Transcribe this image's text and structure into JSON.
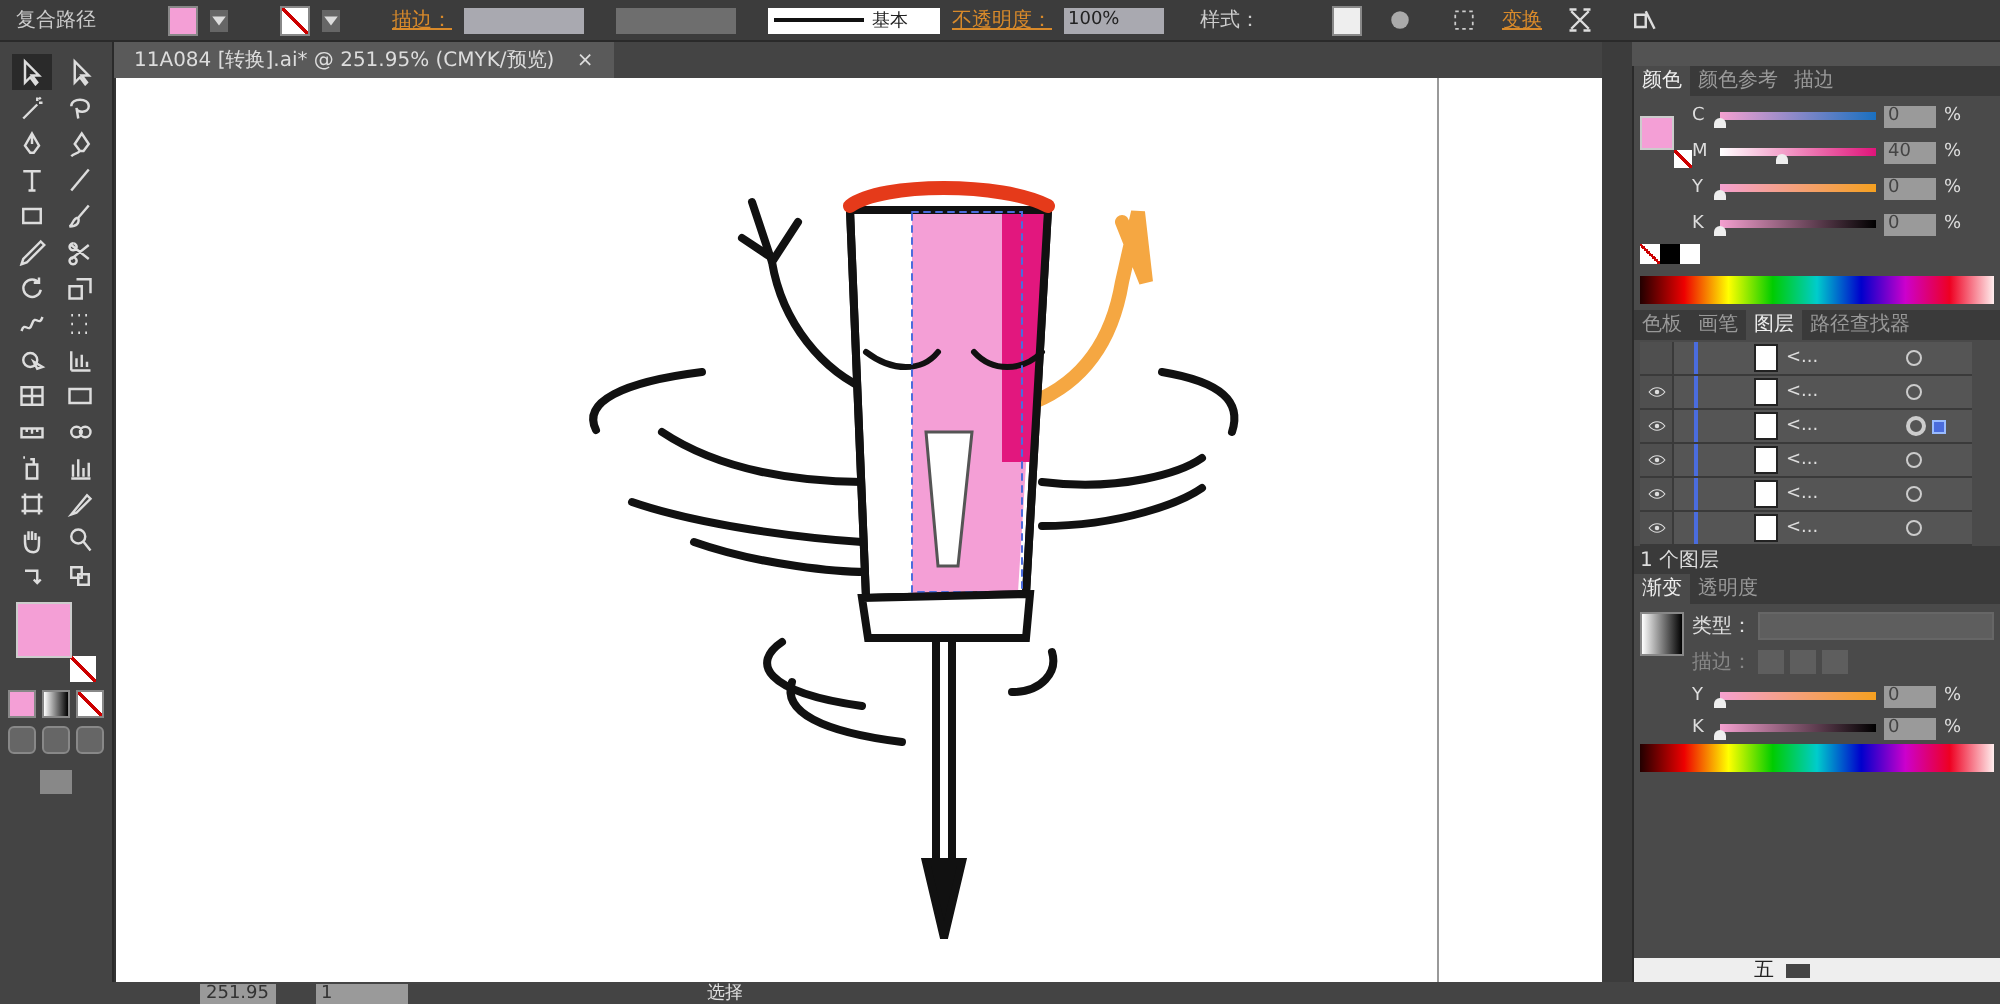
{
  "control_bar": {
    "object_type": "复合路径",
    "stroke_label": "描边：",
    "stroke_profile": "基本",
    "opacity_label": "不透明度：",
    "opacity_value": "100%",
    "style_label": "样式：",
    "transform_link": "变换"
  },
  "document_tab": {
    "title": "11A084 [转换].ai* @ 251.95% (CMYK/预览)",
    "close": "×"
  },
  "toolbar": {
    "tools": [
      {
        "selected": true
      },
      {
        "selected": false
      },
      {
        "selected": false
      },
      {
        "selected": false
      },
      {
        "selected": false
      },
      {
        "selected": false
      },
      {
        "selected": false
      },
      {
        "selected": false
      },
      {
        "selected": false
      },
      {
        "selected": false
      },
      {
        "selected": false
      },
      {
        "selected": false
      },
      {
        "selected": false
      },
      {
        "selected": false
      },
      {
        "selected": false
      },
      {
        "selected": false
      },
      {
        "selected": false
      },
      {
        "selected": false
      },
      {
        "selected": false
      },
      {
        "selected": false
      },
      {
        "selected": false
      },
      {
        "selected": false
      },
      {
        "selected": false
      },
      {
        "selected": false
      },
      {
        "selected": false
      },
      {
        "selected": false
      },
      {
        "selected": false
      },
      {
        "selected": false
      },
      {
        "selected": false
      },
      {
        "selected": false
      }
    ]
  },
  "color_panel": {
    "tabs": [
      {
        "label": "颜色",
        "selected": true
      },
      {
        "label": "颜色参考",
        "selected": false
      },
      {
        "label": "描边",
        "selected": false
      }
    ],
    "sliders": [
      {
        "channel": "C",
        "level": 0,
        "value": "0",
        "unit": "%"
      },
      {
        "channel": "M",
        "level": 0.4,
        "value": "40",
        "unit": "%"
      },
      {
        "channel": "Y",
        "level": 0,
        "value": "0",
        "unit": "%"
      },
      {
        "channel": "K",
        "level": 0,
        "value": "0",
        "unit": "%"
      }
    ]
  },
  "layers_panel": {
    "tabs": [
      {
        "label": "色板",
        "selected": false
      },
      {
        "label": "画笔",
        "selected": false
      },
      {
        "label": "图层",
        "selected": true
      },
      {
        "label": "路径查找器",
        "selected": false
      }
    ],
    "rows": [
      {
        "visible": false,
        "name": "<...",
        "selected": false
      },
      {
        "visible": true,
        "name": "<...",
        "selected": false
      },
      {
        "visible": true,
        "name": "<...",
        "selected": true
      },
      {
        "visible": true,
        "name": "<...",
        "selected": false
      },
      {
        "visible": true,
        "name": "<...",
        "selected": false
      },
      {
        "visible": true,
        "name": "<...",
        "selected": false
      }
    ],
    "footer": "1 个图层"
  },
  "gradient_panel": {
    "tabs": [
      {
        "label": "渐变",
        "selected": true
      },
      {
        "label": "透明度",
        "selected": false
      }
    ],
    "type_label": "类型：",
    "stroke_label": "描边：",
    "sliders": [
      {
        "channel": "Y",
        "level": 0,
        "value": "0",
        "unit": "%"
      },
      {
        "channel": "K",
        "level": 0,
        "value": "0",
        "unit": "%"
      }
    ]
  },
  "status_bar": {
    "zoom": "251.95",
    "artboard": "1",
    "tool": "选择"
  },
  "tray": {
    "ime": "五"
  }
}
